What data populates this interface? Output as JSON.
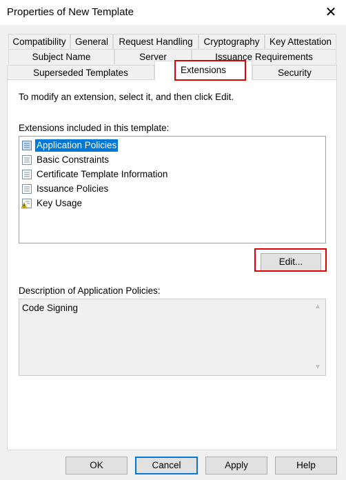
{
  "window": {
    "title": "Properties of New Template",
    "close_glyph": "✕"
  },
  "tabs": {
    "row1": [
      "Compatibility",
      "General",
      "Request Handling",
      "Cryptography",
      "Key Attestation"
    ],
    "row2": [
      "Subject Name",
      "Server",
      "Issuance Requirements"
    ],
    "row3": [
      "Superseded Templates",
      "Extensions",
      "Security"
    ],
    "active": "Extensions"
  },
  "extensions": {
    "instruction": "To modify an extension, select it, and then click Edit.",
    "list_label": "Extensions included in this template:",
    "items": [
      {
        "label": "Application Policies",
        "icon": "document-list-icon",
        "selected": true
      },
      {
        "label": "Basic Constraints",
        "icon": "document-list-icon",
        "selected": false
      },
      {
        "label": "Certificate Template Information",
        "icon": "document-list-icon",
        "selected": false
      },
      {
        "label": "Issuance Policies",
        "icon": "document-list-icon",
        "selected": false
      },
      {
        "label": "Key Usage",
        "icon": "warning-document-icon",
        "selected": false
      }
    ],
    "edit_label": "Edit...",
    "description_label": "Description of Application Policies:",
    "description_text": "Code Signing"
  },
  "footer": {
    "ok": "OK",
    "cancel": "Cancel",
    "apply": "Apply",
    "help": "Help"
  },
  "colors": {
    "selection": "#0078d7",
    "highlight": "#e00000",
    "dialog_bg": "#f0f0f0"
  }
}
